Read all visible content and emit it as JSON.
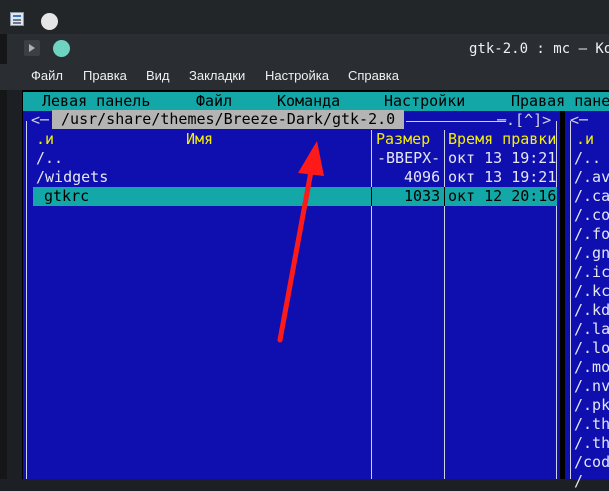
{
  "window": {
    "title": "gtk-2.0 : mc — Ko"
  },
  "menubar": {
    "items": [
      "Файл",
      "Правка",
      "Вид",
      "Закладки",
      "Настройка",
      "Справка"
    ]
  },
  "mc_menu": {
    "items": [
      "Левая панель",
      "Файл",
      "Команда",
      "Настройки",
      "Правая пане"
    ]
  },
  "left_panel": {
    "corner_left": "<─",
    "path": " /usr/share/themes/Breeze-Dark/gtk-2.0 ",
    "corner_right": "─.[^]>",
    "headers": {
      "sort": ".и",
      "name": "Имя",
      "size": "Размер",
      "time": "Время правки"
    },
    "rows": [
      {
        "name": "/..",
        "size": "-ВВЕРХ-",
        "time": "окт 13 19:21",
        "selected": false
      },
      {
        "name": "/widgets",
        "size": "4096",
        "time": "окт 13 19:21",
        "selected": false
      },
      {
        "name": "gtkrc",
        "size": "1033",
        "time": "окт 12 20:16",
        "selected": true
      }
    ]
  },
  "right_panel": {
    "corner_left": "<─",
    "header": ".и",
    "rows": [
      "/..",
      "/.av",
      "/.ca",
      "/.co",
      "/.fo",
      "/.gn",
      "/.ic",
      "/.kc",
      "/.kd",
      "/.la",
      "/.lo",
      "/.mo",
      "/.nv",
      "/.pk",
      "/.th",
      "/.th",
      "/cod",
      "/"
    ]
  },
  "colors": {
    "panel_bg": "#0f0fb0",
    "highlight": "#13a7a7",
    "header_text": "#f4f000",
    "annotation_arrow": "#ff1a1a"
  }
}
